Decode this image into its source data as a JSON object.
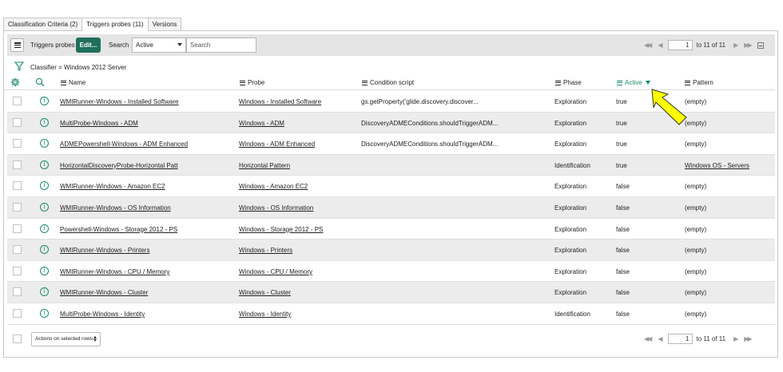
{
  "tabs": [
    {
      "label": "Classification Criteria (2)",
      "active": false
    },
    {
      "label": "Triggers probes (11)",
      "active": true
    },
    {
      "label": "Versions",
      "active": false
    }
  ],
  "toolbar": {
    "title": "Triggers probes",
    "edit_label": "Edit...",
    "search_label": "Search",
    "search_field": "Active",
    "search_placeholder": "Search"
  },
  "pager_top": {
    "page": "1",
    "range": "to 11 of 11"
  },
  "pager_bottom": {
    "page": "1",
    "range": "to 11 of 11"
  },
  "breadcrumb": "Classifier = Windows 2012 Server",
  "columns": {
    "name": "Name",
    "probe": "Probe",
    "condition": "Condition script",
    "phase": "Phase",
    "active": "Active",
    "pattern": "Pattern"
  },
  "sorted_column": "Active",
  "rows": [
    {
      "name": "WMIRunner-Windows - Installed Software",
      "probe": "Windows - Installed Software",
      "condition": "gs.getProperty('glide.discovery.discover...",
      "phase": "Exploration",
      "active": "true",
      "pattern": "(empty)",
      "pattern_link": false
    },
    {
      "name": "MultiProbe-Windows - ADM",
      "probe": "Windows - ADM",
      "condition": "DiscoveryADMEConditions.shouldTriggerADM...",
      "phase": "Exploration",
      "active": "true",
      "pattern": "(empty)",
      "pattern_link": false
    },
    {
      "name": "ADMEPowershell-Windows - ADM Enhanced",
      "probe": "Windows - ADM Enhanced",
      "condition": "DiscoveryADMEConditions.shouldTriggerADM...",
      "phase": "Exploration",
      "active": "true",
      "pattern": "(empty)",
      "pattern_link": false
    },
    {
      "name": "HorizontalDiscoveryProbe-Horizontal Patt",
      "probe": "Horizontal Pattern",
      "condition": "",
      "phase": "Identification",
      "active": "true",
      "pattern": "Windows OS - Servers",
      "pattern_link": true
    },
    {
      "name": "WMIRunner-Windows - Amazon EC2",
      "probe": "Windows - Amazon EC2",
      "condition": "",
      "phase": "Exploration",
      "active": "false",
      "pattern": "(empty)",
      "pattern_link": false
    },
    {
      "name": "WMIRunner-Windows - OS Information",
      "probe": "Windows - OS Information",
      "condition": "",
      "phase": "Exploration",
      "active": "false",
      "pattern": "(empty)",
      "pattern_link": false
    },
    {
      "name": "Powershell-Windows - Storage 2012 - PS",
      "probe": "Windows - Storage 2012 - PS",
      "condition": "",
      "phase": "Exploration",
      "active": "false",
      "pattern": "(empty)",
      "pattern_link": false
    },
    {
      "name": "WMIRunner-Windows - Printers",
      "probe": "Windows - Printers",
      "condition": "",
      "phase": "Exploration",
      "active": "false",
      "pattern": "(empty)",
      "pattern_link": false
    },
    {
      "name": "WMIRunner-Windows - CPU / Memory",
      "probe": "Windows - CPU / Memory",
      "condition": "",
      "phase": "Exploration",
      "active": "false",
      "pattern": "(empty)",
      "pattern_link": false
    },
    {
      "name": "WMIRunner-Windows - Cluster",
      "probe": "Windows - Cluster",
      "condition": "",
      "phase": "Exploration",
      "active": "false",
      "pattern": "(empty)",
      "pattern_link": false
    },
    {
      "name": "MultiProbe-Windows - Identity",
      "probe": "Windows - Identity",
      "condition": "",
      "phase": "Identification",
      "active": "false",
      "pattern": "(empty)",
      "pattern_link": false
    }
  ],
  "footer": {
    "actions_label": "Actions on selected rows..."
  },
  "icons": {
    "menu": "hamburger-icon",
    "filter": "filter-funnel-icon",
    "settings": "gear-icon",
    "search": "search-icon",
    "info": "info-icon",
    "first": "first-page-icon",
    "prev": "previous-page-icon",
    "next": "next-page-icon",
    "last": "last-page-icon",
    "collapse": "collapse-icon",
    "annotation": "yellow-arrow-icon"
  },
  "colors": {
    "accent": "#1a8c6c",
    "edit_button": "#1f6f5c",
    "annotation": "#ffff00"
  }
}
